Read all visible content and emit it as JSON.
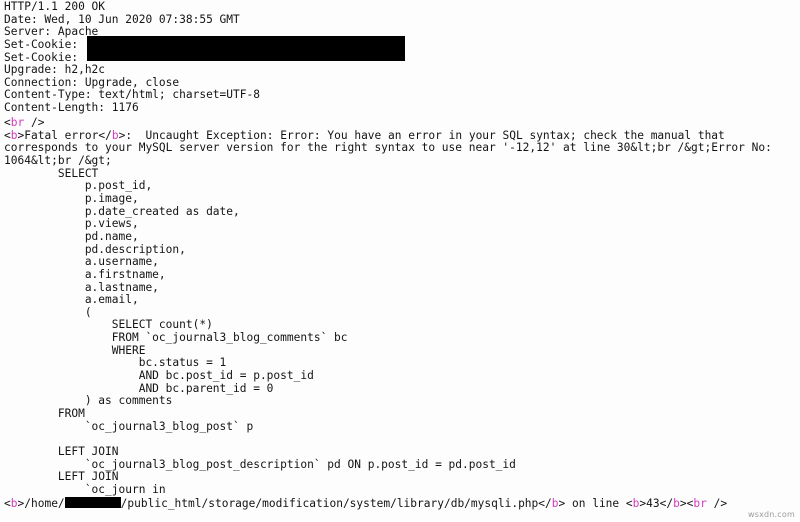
{
  "viewer": {
    "background_color": "#fdfdfd",
    "text_color": "#141414",
    "tag_color": "#d63bbd",
    "redaction_color": "#000000"
  },
  "http_headers": {
    "status_line": "HTTP/1.1 200 OK",
    "lines": [
      {
        "name": "Date",
        "text": "Date: Wed, 10 Jun 2020 07:38:55 GMT"
      },
      {
        "name": "Server",
        "text": "Server: Apache"
      },
      {
        "name": "Set-Cookie",
        "text": "Set-Cookie:"
      },
      {
        "name": "Set-Cookie",
        "text": "Set-Cookie:"
      },
      {
        "name": "Upgrade",
        "text": "Upgrade: h2,h2c"
      },
      {
        "name": "Connection",
        "text": "Connection: Upgrade, close"
      },
      {
        "name": "Content-Type",
        "text": "Content-Type: text/html; charset=UTF-8"
      },
      {
        "name": "Content-Length",
        "text": "Content-Length: 1176"
      }
    ]
  },
  "body": {
    "br_line": {
      "open_bracket": "<",
      "tag": "br",
      "close": " />"
    },
    "fatal": {
      "open_bracket": "<",
      "tag_open": "b",
      "gt": ">",
      "label": "Fatal error",
      "close_open": "</",
      "tag_close": "b",
      "close_gt": ">",
      "message": ":  Uncaught Exception: Error: You have an error in your SQL syntax; check the manual that corresponds to your MySQL server version for the right syntax to use near '-12,12' at line 30&lt;br /&gt;Error No: 1064&lt;br /&gt;"
    },
    "sql": "        SELECT\n            p.post_id,\n            p.image,\n            p.date_created as date,\n            p.views,\n            pd.name,\n            pd.description,\n            a.username,\n            a.firstname,\n            a.lastname,\n            a.email,\n            (\n                SELECT count(*)\n                FROM `oc_journal3_blog_comments` bc\n                WHERE\n                    bc.status = 1\n                    AND bc.post_id = p.post_id\n                    AND bc.parent_id = 0\n            ) as comments\n        FROM\n            `oc_journal3_blog_post` p\n\n        LEFT JOIN\n            `oc_journal3_blog_post_description` pd ON p.post_id = pd.post_id\n        LEFT JOIN\n            `oc_journ in",
    "trace": {
      "open_bracket": "<",
      "tag_open": "b",
      "gt": ">",
      "path_prefix": "/home/",
      "path_suffix": "/public_html/storage/modification/system/library/db/mysqli.php",
      "close_open": "</",
      "tag_close": "b",
      "close_gt": ">",
      "on_line_text": " on line ",
      "line_open_bracket": "<",
      "line_tag_open": "b",
      "line_gt": ">",
      "line_number": "43",
      "line_close_open": "</",
      "line_tag_close": "b",
      "line_close_gt": ">",
      "br_open": "<",
      "br_tag": "br",
      "br_close": " />"
    }
  },
  "watermark": {
    "text": "wsxdn.com"
  }
}
